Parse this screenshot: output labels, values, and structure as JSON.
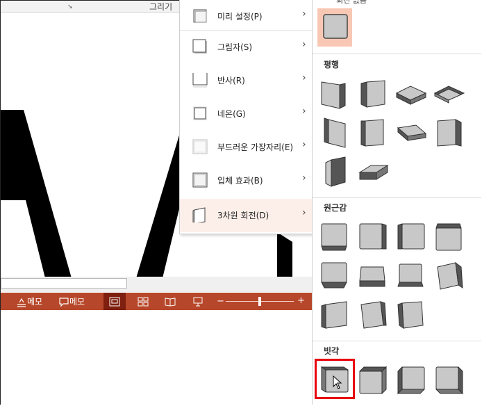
{
  "ribbon": {
    "group_label": "그리기",
    "launcher_glyph": "↘"
  },
  "menu": {
    "items": [
      {
        "label": "미리 설정(P)",
        "icon": "preset-icon"
      },
      {
        "label": "그림자(S)",
        "icon": "shadow-icon"
      },
      {
        "label": "반사(R)",
        "icon": "reflection-icon"
      },
      {
        "label": "네온(G)",
        "icon": "glow-icon"
      },
      {
        "label": "부드러운 가장자리(E)",
        "icon": "soft-edges-icon"
      },
      {
        "label": "입체 효과(B)",
        "icon": "bevel-icon"
      },
      {
        "label": "3차원 회전(D)",
        "icon": "3d-rotation-icon",
        "active": true
      }
    ],
    "arrow": "›"
  },
  "gallery": {
    "top_label": "회전 없음",
    "sections": [
      {
        "label": "평행",
        "count": 10
      },
      {
        "label": "원근감",
        "count": 11
      },
      {
        "label": "빗각",
        "count": 4
      }
    ]
  },
  "status_bar": {
    "notes_label": "메모",
    "comments_label": "메모",
    "zoom_minus": "−",
    "zoom_plus": "+",
    "zoom_level": 0.5
  },
  "colors": {
    "accent": "#b7472a",
    "accent_dark": "#7e1f0f",
    "menu_active": "#fcefe9",
    "selected_tile": "#f8c8b4",
    "highlight_box": "#e8000d",
    "tile_face": "#c8c8c8"
  }
}
